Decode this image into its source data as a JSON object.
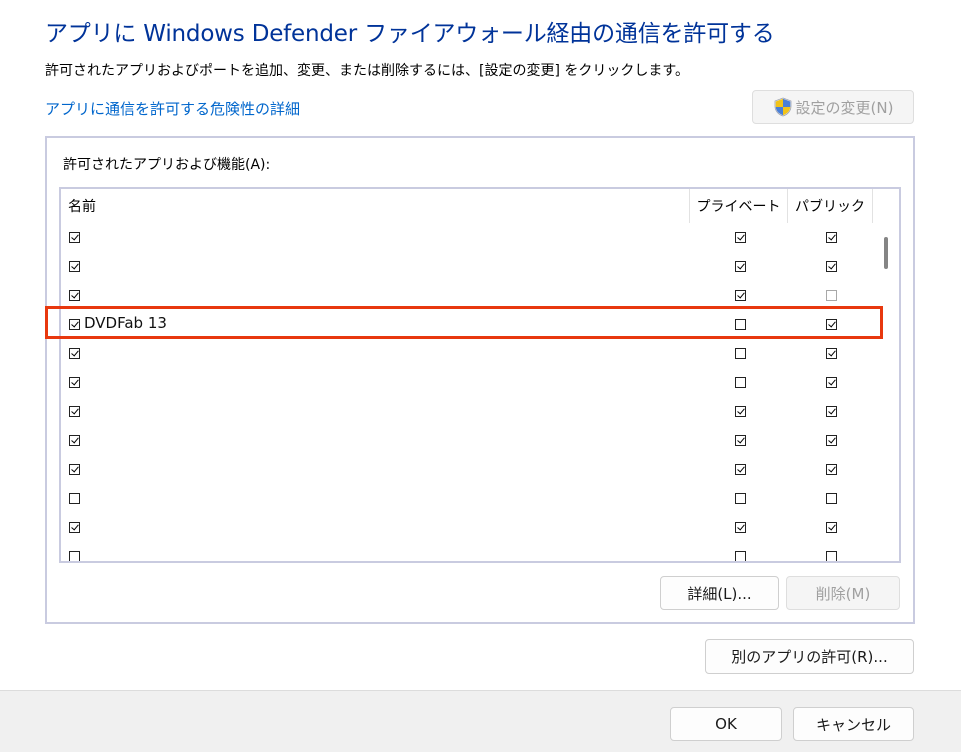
{
  "dialog": {
    "title": "アプリに Windows Defender ファイアウォール経由の通信を許可する",
    "subtitle": "許可されたアプリおよびポートを追加、変更、または削除するには、[設定の変更] をクリックします。",
    "risk_link": "アプリに通信を許可する危険性の詳細",
    "change_settings_label": "設定の変更(N)"
  },
  "group": {
    "label": "許可されたアプリおよび機能(A):"
  },
  "table": {
    "columns": {
      "name": "名前",
      "private": "プライベート",
      "public": "パブリック"
    },
    "rows": [
      {
        "name": "",
        "enabled": true,
        "private": true,
        "public": true
      },
      {
        "name": "",
        "enabled": true,
        "private": true,
        "public": true
      },
      {
        "name": "",
        "enabled": true,
        "private": true,
        "public": false
      },
      {
        "name": "DVDFab 13",
        "enabled": true,
        "private": false,
        "public": true
      },
      {
        "name": "",
        "enabled": true,
        "private": false,
        "public": true
      },
      {
        "name": "",
        "enabled": true,
        "private": false,
        "public": true
      },
      {
        "name": "",
        "enabled": true,
        "private": true,
        "public": true
      },
      {
        "name": "",
        "enabled": true,
        "private": true,
        "public": true
      },
      {
        "name": "",
        "enabled": true,
        "private": true,
        "public": true
      },
      {
        "name": "",
        "enabled": false,
        "private": false,
        "public": false
      },
      {
        "name": "",
        "enabled": true,
        "private": true,
        "public": true
      },
      {
        "name": "",
        "enabled": false,
        "private": false,
        "public": false
      }
    ]
  },
  "buttons": {
    "details": "詳細(L)...",
    "remove": "削除(M)",
    "allow_another": "別のアプリの許可(R)...",
    "ok": "OK",
    "cancel": "キャンセル"
  },
  "colors": {
    "title": "#003399",
    "link": "#0066cc",
    "highlight": "#e8380e"
  }
}
